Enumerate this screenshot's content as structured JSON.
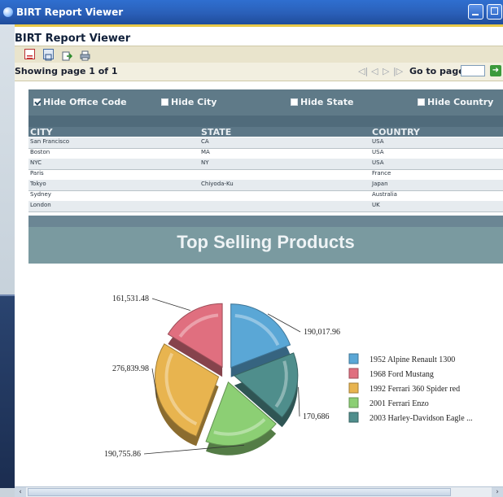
{
  "window": {
    "title": "BIRT Report Viewer"
  },
  "viewer": {
    "title": "BIRT Report Viewer",
    "toolbar": {
      "icons": [
        "toc-icon",
        "parameters-icon",
        "export-icon",
        "print-icon"
      ]
    },
    "nav": {
      "showing": "Showing page  1  of  1",
      "goto_label": "Go to page:",
      "goto_value": ""
    }
  },
  "filters": [
    {
      "label": "Hide Office Code",
      "checked": true
    },
    {
      "label": "Hide City",
      "checked": false
    },
    {
      "label": "Hide State",
      "checked": false
    },
    {
      "label": "Hide Country",
      "checked": false
    }
  ],
  "table": {
    "headers": [
      "CITY",
      "STATE",
      "COUNTRY"
    ],
    "rows": [
      [
        "San Francisco",
        "CA",
        "USA"
      ],
      [
        "Boston",
        "MA",
        "USA"
      ],
      [
        "NYC",
        "NY",
        "USA"
      ],
      [
        "Paris",
        "",
        "France"
      ],
      [
        "Tokyo",
        "Chiyoda-Ku",
        "Japan"
      ],
      [
        "Sydney",
        "",
        "Australia"
      ],
      [
        "London",
        "",
        "UK"
      ]
    ]
  },
  "section_title": "Top Selling Products",
  "chart_data": {
    "type": "pie",
    "title": "",
    "categories": [
      "1952 Alpine Renault 1300",
      "1968 Ford Mustang",
      "1992 Ferrari 360 Spider red",
      "2001 Ferrari Enzo",
      "2003 Harley-Davidson Eagle ..."
    ],
    "values": [
      190017.96,
      161531.48,
      276839.98,
      190755.86,
      170686
    ],
    "value_labels": [
      "190,017.96",
      "161,531.48",
      "276,839.98",
      "190,755.86",
      "170,686"
    ],
    "colors": [
      "#5aa7d6",
      "#e06f7f",
      "#e8b44f",
      "#8ccf74",
      "#4f8e8c"
    ],
    "legend_position": "right",
    "exploded": true,
    "style": "3d"
  }
}
